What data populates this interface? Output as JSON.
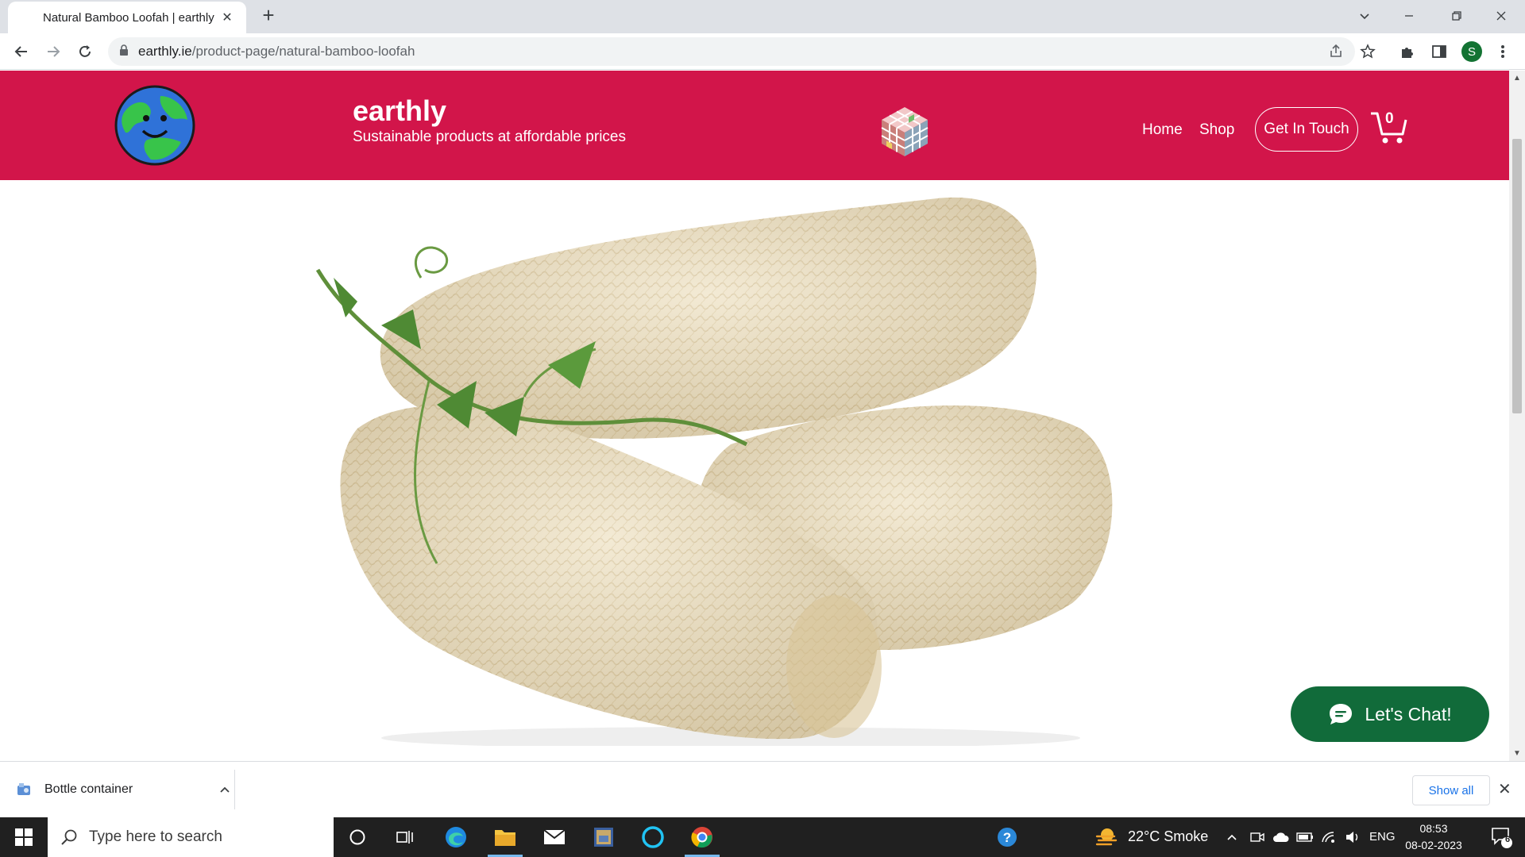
{
  "browser": {
    "tab_title": "Natural Bamboo Loofah | earthly",
    "tab_close": "✕",
    "new_tab": "+",
    "url_domain": "earthly.ie",
    "url_path": "/product-page/natural-bamboo-loofah",
    "profile_initial": "S"
  },
  "site": {
    "brand_name": "earthly",
    "tagline": "Sustainable products at affordable prices",
    "nav": {
      "home": "Home",
      "shop": "Shop",
      "contact": "Get In Touch"
    },
    "cart_count": "0"
  },
  "chat": {
    "label": "Let's Chat!"
  },
  "downloads": {
    "item_name": "Bottle container",
    "show_all": "Show all",
    "close": "✕"
  },
  "taskbar": {
    "search_placeholder": "Type here to search",
    "weather": "22°C  Smoke",
    "language": "ENG",
    "time": "08:53",
    "date": "08-02-2023",
    "notifications": "6"
  },
  "colors": {
    "header_bg": "#d2154a",
    "chat_bg": "#116b3a",
    "link_blue": "#1a73e8"
  }
}
